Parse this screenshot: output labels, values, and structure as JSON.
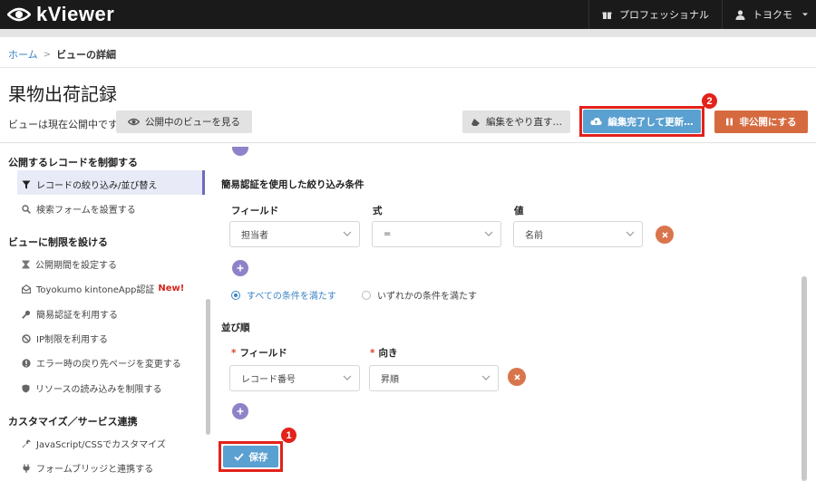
{
  "app": {
    "name": "kViewer"
  },
  "topbar": {
    "plan_label": "プロフェッショナル",
    "user_name": "トヨクモ"
  },
  "breadcrumb": {
    "home": "ホーム",
    "current": "ビューの詳細"
  },
  "page": {
    "title": "果物出荷記録",
    "status": "ビューは現在公開中です"
  },
  "actions": {
    "view_public": "公開中のビューを見る",
    "redo": "編集をやり直す…",
    "update": "編集完了して更新…",
    "unpublish": "非公開にする"
  },
  "callouts": {
    "one": "1",
    "two": "2"
  },
  "sidebar": {
    "section1": "公開するレコードを制御する",
    "filter_sort": "レコードの絞り込み/並び替え",
    "search_form": "検索フォームを設置する",
    "section2": "ビューに制限を設ける",
    "period": "公開期間を設定する",
    "app_auth": "Toyokumo kintoneApp認証",
    "new_badge": "New!",
    "simple_auth": "簡易認証を利用する",
    "ip_limit": "IP制限を利用する",
    "error_page": "エラー時の戻り先ページを変更する",
    "resource_limit": "リソースの読み込みを制限する",
    "section3": "カスタマイズ／サービス連携",
    "js_css": "JavaScript/CSSでカスタマイズ",
    "form_bridge": "フォームブリッジと連携する"
  },
  "filter": {
    "heading": "簡易認証を使用した絞り込み条件",
    "col_field": "フィールド",
    "col_expr": "式",
    "col_value": "値",
    "field_value": "担当者",
    "expr_value": "=",
    "value_value": "名前",
    "radio_all": "すべての条件を満たす",
    "radio_any": "いずれかの条件を満たす",
    "radio_selected": "all"
  },
  "sort": {
    "heading": "並び順",
    "col_field": "フィールド",
    "col_dir": "向き",
    "required_mark": "*",
    "field_value": "レコード番号",
    "dir_value": "昇順"
  },
  "save": {
    "label": "保存"
  },
  "colors": {
    "accent_blue": "#5aa0d0",
    "orange": "#d66a3f",
    "purple": "#8f82c9",
    "callout_red": "#e2221b"
  }
}
